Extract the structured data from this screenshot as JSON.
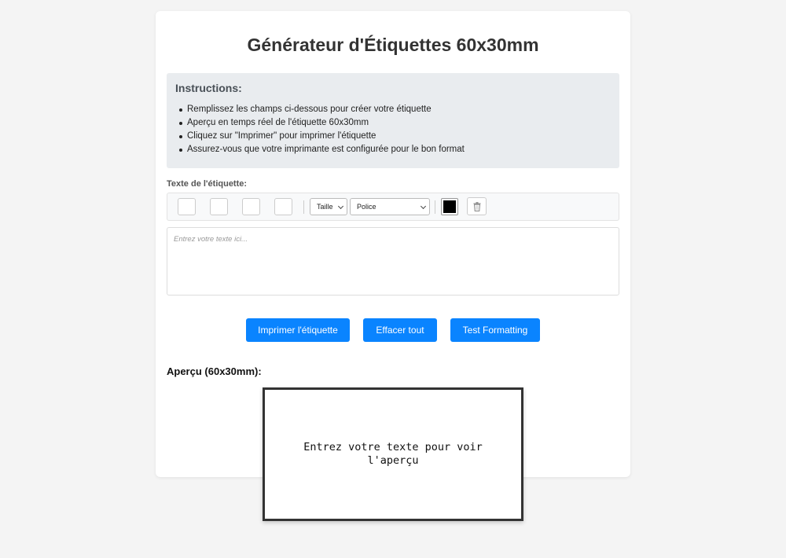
{
  "page": {
    "title": "Générateur d'Étiquettes 60x30mm"
  },
  "instructions": {
    "heading": "Instructions:",
    "items": [
      "Remplissez les champs ci-dessous pour créer votre étiquette",
      "Aperçu en temps réel de l'étiquette 60x30mm",
      "Cliquez sur \"Imprimer\" pour imprimer l'étiquette",
      "Assurez-vous que votre imprimante est configurée pour le bon format"
    ]
  },
  "editor": {
    "label": "Texte de l'étiquette:",
    "size_select": "Taille",
    "font_select": "Police",
    "text_color": "#000000",
    "textarea_value": "",
    "textarea_placeholder": "Entrez votre texte ici..."
  },
  "actions": {
    "print_label": "Imprimer l'étiquette",
    "clear_label": "Effacer tout",
    "test_label": "Test Formatting"
  },
  "preview": {
    "label": "Aperçu (60x30mm):",
    "placeholder": "Entrez votre texte pour voir l'aperçu"
  },
  "colors": {
    "accent": "#0a84ff",
    "instructions_bg": "#e9ecef"
  }
}
